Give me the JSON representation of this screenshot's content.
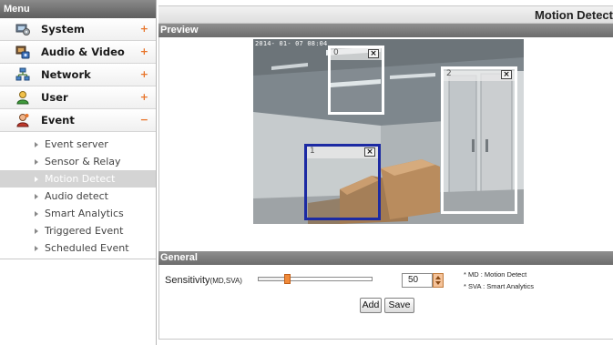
{
  "sidebar": {
    "header": "Menu",
    "categories": [
      {
        "label": "System",
        "toggle": "+",
        "icon": "system-icon"
      },
      {
        "label": "Audio & Video",
        "toggle": "+",
        "icon": "audio-video-icon"
      },
      {
        "label": "Network",
        "toggle": "+",
        "icon": "network-icon"
      },
      {
        "label": "User",
        "toggle": "+",
        "icon": "user-icon"
      },
      {
        "label": "Event",
        "toggle": "−",
        "icon": "event-icon"
      }
    ],
    "event_items": [
      {
        "label": "Event server"
      },
      {
        "label": "Sensor & Relay"
      },
      {
        "label": "Motion Detect",
        "active": true
      },
      {
        "label": "Audio detect"
      },
      {
        "label": "Smart Analytics"
      },
      {
        "label": "Triggered Event"
      },
      {
        "label": "Scheduled Event"
      }
    ]
  },
  "page": {
    "title": "Motion Detect"
  },
  "preview": {
    "section_label": "Preview",
    "timestamp": "2014- 01- 07  08:04",
    "zones": [
      {
        "label": "0",
        "close": "×",
        "selected": false
      },
      {
        "label": "1",
        "close": "×",
        "selected": true
      },
      {
        "label": "2",
        "close": "×",
        "selected": false
      }
    ]
  },
  "general": {
    "section_label": "General",
    "sensitivity_label": "Sensitivity",
    "sensitivity_suffix": "(MD,SVA)",
    "sensitivity_value": "50",
    "sensitivity_fraction": 0.25,
    "legend_md": "* MD : Motion Detect",
    "legend_sva": "* SVA : Smart Analytics",
    "add_label": "Add",
    "save_label": "Save"
  },
  "colors": {
    "accent_orange": "#f08a3a",
    "selected_zone": "#1c2aa3",
    "section_bar": "#7a7a7a"
  }
}
